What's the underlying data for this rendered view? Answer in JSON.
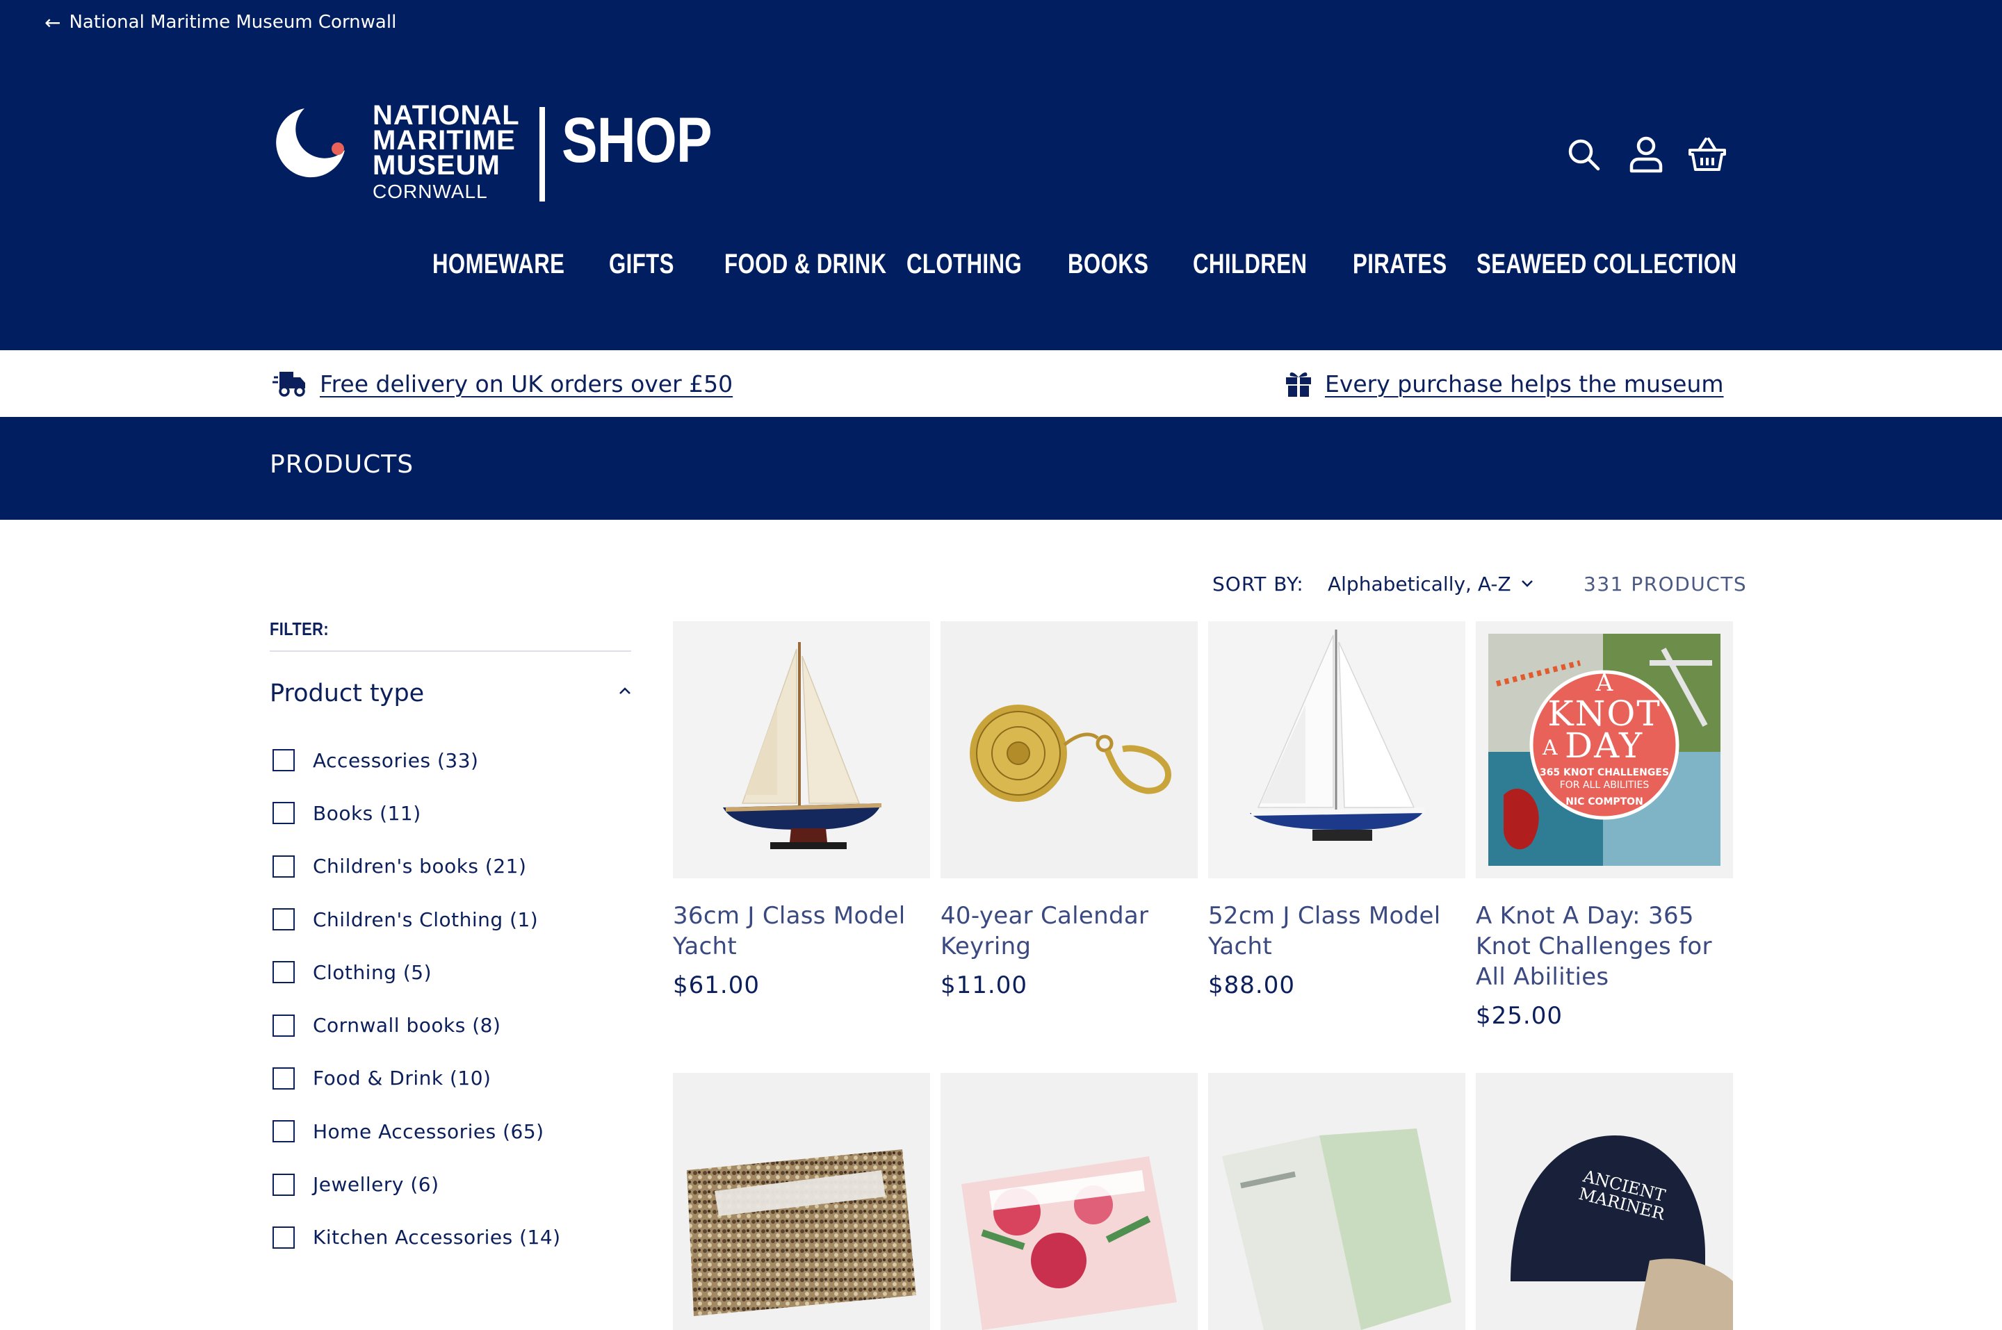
{
  "header": {
    "back_link": "National Maritime Museum Cornwall",
    "logo": {
      "line1": "NATIONAL",
      "line2": "MARITIME",
      "line3": "MUSEUM",
      "line4": "CORNWALL",
      "shop": "SHOP"
    },
    "icons": [
      "search-icon",
      "account-icon",
      "cart-icon"
    ],
    "nav": [
      "HOMEWARE",
      "GIFTS",
      "FOOD & DRINK",
      "CLOTHING",
      "BOOKS",
      "CHILDREN",
      "PIRATES",
      "SEAWEED COLLECTION"
    ]
  },
  "promo": {
    "delivery": "Free delivery on UK orders over £50",
    "museum": "Every purchase helps the museum"
  },
  "page_title": "PRODUCTS",
  "sort": {
    "label": "SORT BY:",
    "selected": "Alphabetically, A-Z",
    "count": "331 PRODUCTS"
  },
  "filters": {
    "label": "FILTER:",
    "facet_title": "Product type",
    "options": [
      "Accessories (33)",
      "Books (11)",
      "Children's books (21)",
      "Children's Clothing (1)",
      "Clothing (5)",
      "Cornwall books (8)",
      "Food & Drink (10)",
      "Home Accessories (65)",
      "Jewellery (6)",
      "Kitchen Accessories (14)"
    ]
  },
  "products": [
    {
      "name": "36cm J Class Model Yacht",
      "price": "$61.00"
    },
    {
      "name": "40-year Calendar Keyring",
      "price": "$11.00"
    },
    {
      "name": "52cm J Class Model Yacht",
      "price": "$88.00"
    },
    {
      "name": "A Knot A Day: 365 Knot Challenges for All Abilities",
      "price": "$25.00"
    }
  ],
  "book_cover": {
    "a": "A",
    "knot": "KNOT",
    "a2": "A",
    "day": "DAY",
    "sub1": "365 KNOT CHALLENGES",
    "sub2": "FOR ALL ABILITIES",
    "author": "NIC COMPTON"
  },
  "cap_text": {
    "line1": "ANCIENT",
    "line2": "MARINER"
  },
  "colors": {
    "navy": "#001e60",
    "accent": "#e8625a",
    "text": "#0b1f5c"
  }
}
